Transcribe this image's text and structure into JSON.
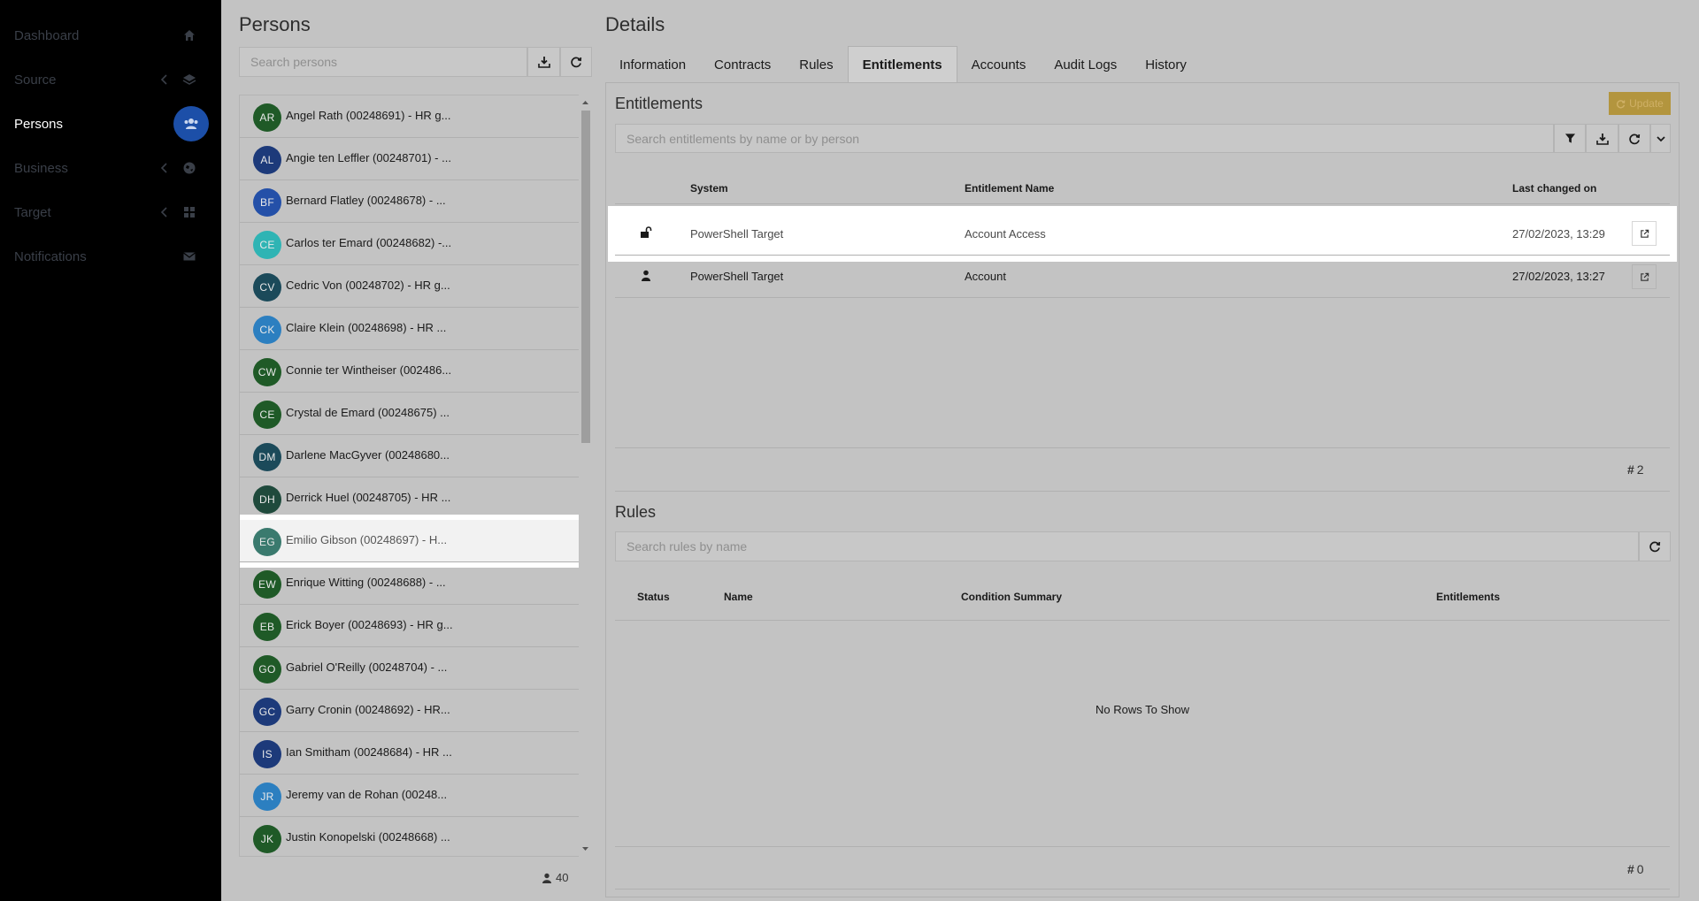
{
  "sidebar": {
    "items": [
      {
        "label": "Dashboard",
        "icon": "home-icon"
      },
      {
        "label": "Source",
        "icon": "layers-icon"
      },
      {
        "label": "Persons",
        "icon": "users-icon"
      },
      {
        "label": "Business",
        "icon": "globe-icon"
      },
      {
        "label": "Target",
        "icon": "grid-icon"
      },
      {
        "label": "Notifications",
        "icon": "envelope-icon"
      }
    ]
  },
  "persons": {
    "title": "Persons",
    "search_placeholder": "Search persons",
    "count": "40",
    "list": [
      {
        "initials": "AR",
        "name": "Angel Rath (00248691) - HR g...",
        "color": "#1f5a27"
      },
      {
        "initials": "AL",
        "name": "Angie ten Leffler (00248701) - ...",
        "color": "#1d3a7a"
      },
      {
        "initials": "BF",
        "name": "Bernard Flatley (00248678) - ...",
        "color": "#2450a8"
      },
      {
        "initials": "CE",
        "name": "Carlos ter Emard (00248682) -...",
        "color": "#2fb4b4"
      },
      {
        "initials": "CV",
        "name": "Cedric Von (00248702) - HR g...",
        "color": "#1b4a5a"
      },
      {
        "initials": "CK",
        "name": "Claire Klein (00248698) - HR ...",
        "color": "#2c7fc0"
      },
      {
        "initials": "CW",
        "name": "Connie ter Wintheiser (002486...",
        "color": "#1f5a27"
      },
      {
        "initials": "CE",
        "name": "Crystal de Emard (00248675) ...",
        "color": "#1f5a27"
      },
      {
        "initials": "DM",
        "name": "Darlene MacGyver (00248680...",
        "color": "#1b4a5a"
      },
      {
        "initials": "DH",
        "name": "Derrick Huel (00248705) - HR ...",
        "color": "#1f4a3c"
      },
      {
        "initials": "EG",
        "name": "Emilio Gibson (00248697) - H...",
        "color": "#3a7a6e"
      },
      {
        "initials": "EW",
        "name": "Enrique Witting (00248688) - ...",
        "color": "#1f5a27"
      },
      {
        "initials": "EB",
        "name": "Erick Boyer (00248693) - HR g...",
        "color": "#1f5a27"
      },
      {
        "initials": "GO",
        "name": "Gabriel O'Reilly (00248704) - ...",
        "color": "#1f5a27"
      },
      {
        "initials": "GC",
        "name": "Garry Cronin (00248692) - HR...",
        "color": "#1d3a7a"
      },
      {
        "initials": "IS",
        "name": "Ian Smitham (00248684) - HR ...",
        "color": "#1d3a7a"
      },
      {
        "initials": "JR",
        "name": "Jeremy van de Rohan (00248...",
        "color": "#2c7fc0"
      },
      {
        "initials": "JK",
        "name": "Justin Konopelski (00248668) ...",
        "color": "#1f5a27"
      }
    ]
  },
  "details": {
    "title": "Details",
    "tabs": [
      "Information",
      "Contracts",
      "Rules",
      "Entitlements",
      "Accounts",
      "Audit Logs",
      "History"
    ],
    "active_tab": "Entitlements"
  },
  "entitlements": {
    "title": "Entitlements",
    "update_label": "Update",
    "search_placeholder": "Search entitlements by name or by person",
    "columns": {
      "system": "System",
      "name": "Entitlement Name",
      "changed": "Last changed on"
    },
    "rows": [
      {
        "icon": "unlock-icon",
        "system": "PowerShell Target",
        "name": "Account Access",
        "changed": "27/02/2023, 13:29"
      },
      {
        "icon": "user-icon",
        "system": "PowerShell Target",
        "name": "Account",
        "changed": "27/02/2023, 13:27"
      }
    ],
    "count": "2"
  },
  "rules": {
    "title": "Rules",
    "search_placeholder": "Search rules by name",
    "columns": {
      "status": "Status",
      "name": "Name",
      "condition": "Condition Summary",
      "entitlements": "Entitlements"
    },
    "empty_text": "No Rows To Show",
    "count": "0"
  }
}
